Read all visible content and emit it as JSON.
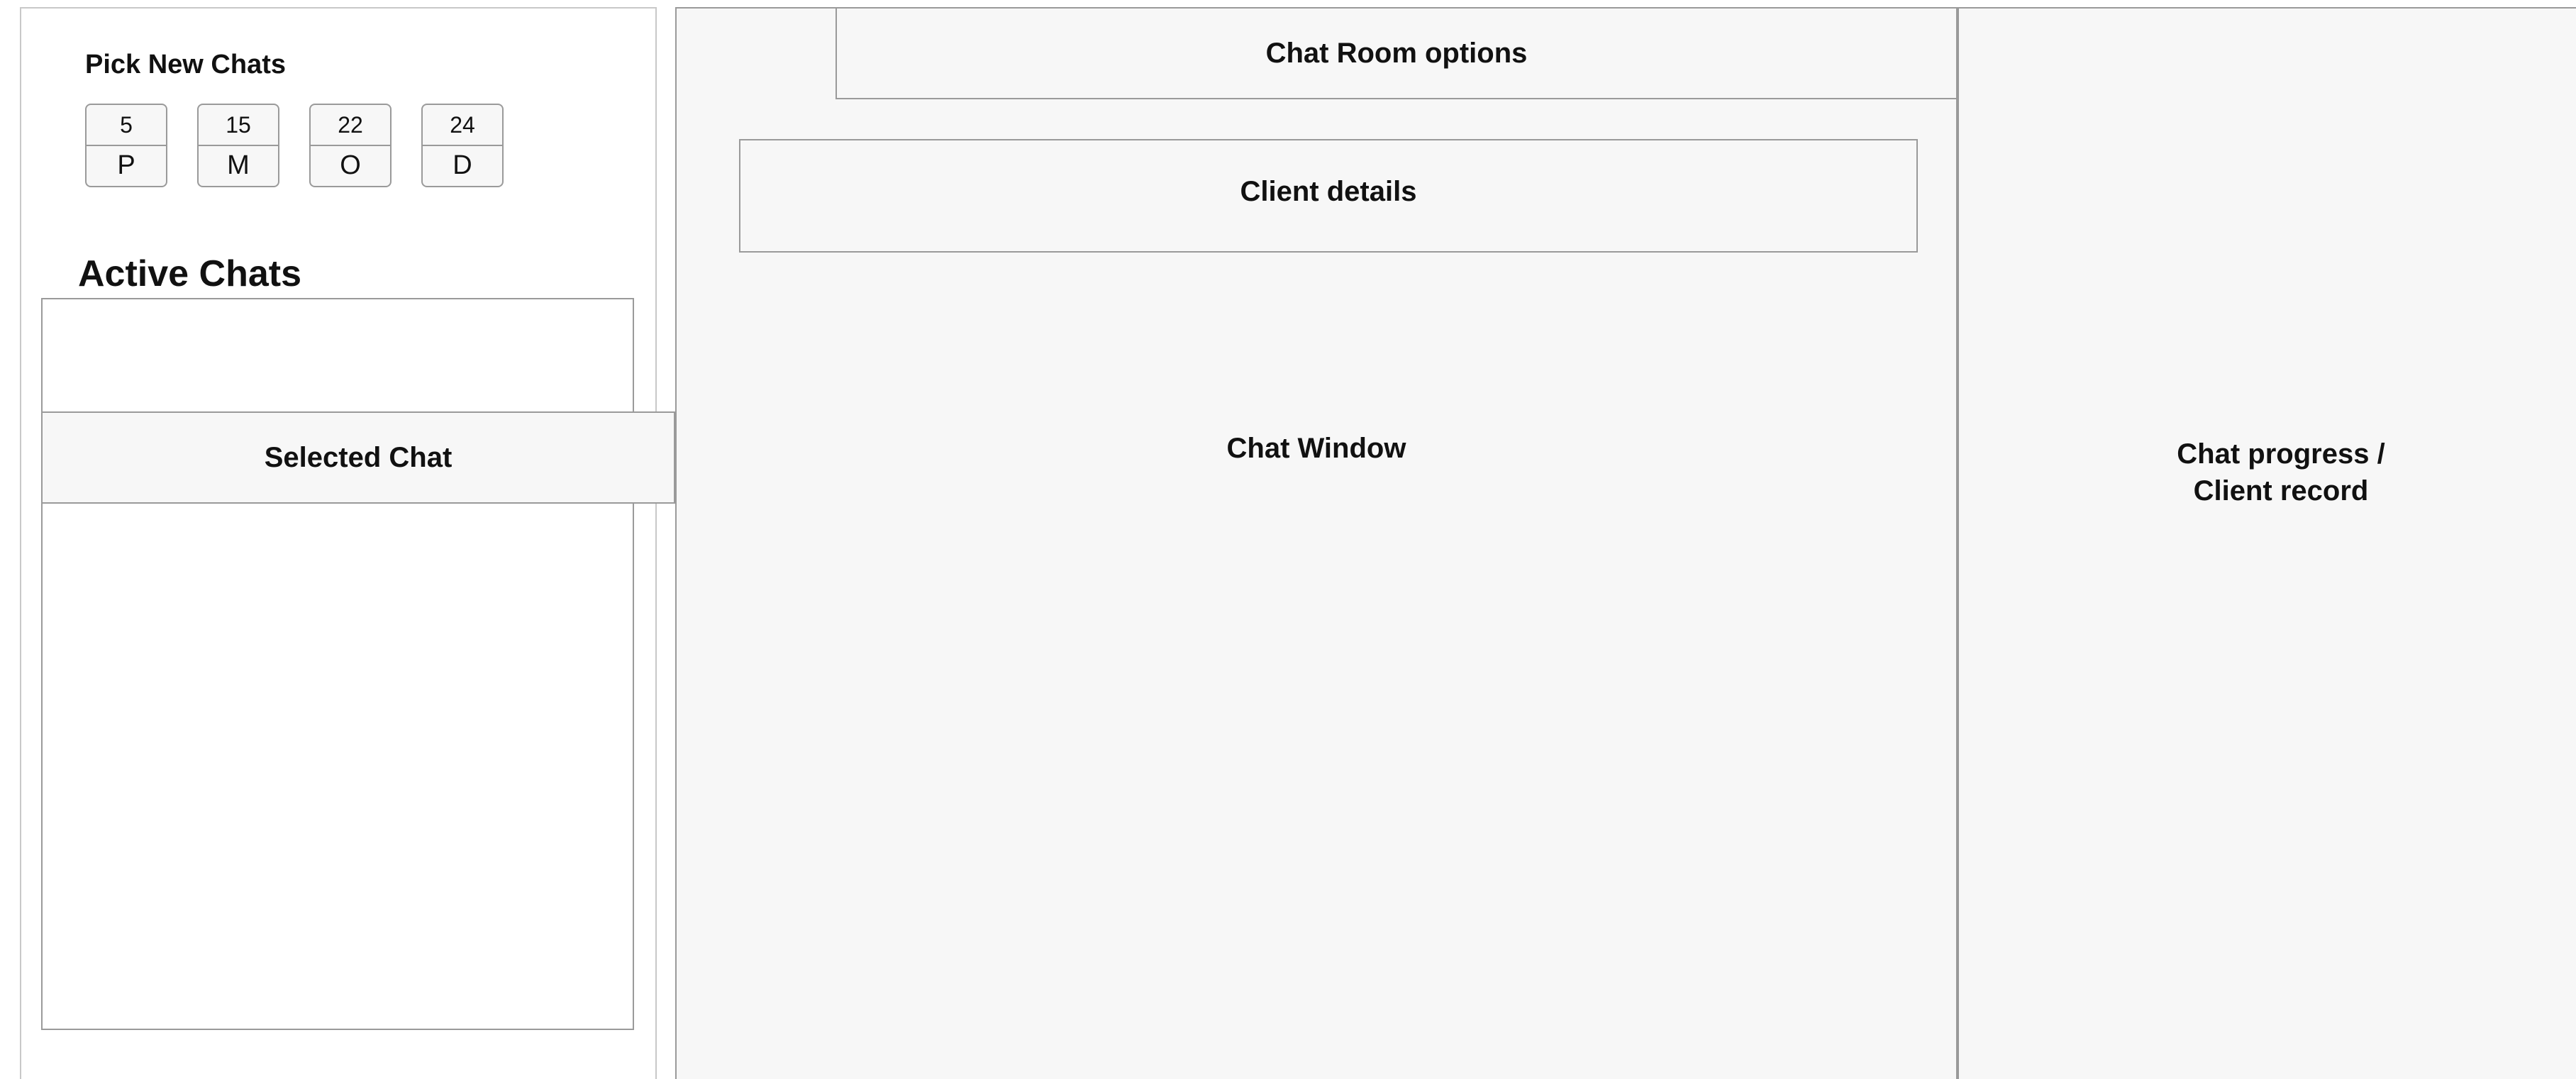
{
  "left_panel": {
    "pick_new_chats_title": "Pick New Chats",
    "queues": [
      {
        "count": "5",
        "letter": "P"
      },
      {
        "count": "15",
        "letter": "M"
      },
      {
        "count": "22",
        "letter": "O"
      },
      {
        "count": "24",
        "letter": "D"
      }
    ],
    "active_chats_title": "Active Chats",
    "selected_chat_label": "Selected Chat"
  },
  "chat_area": {
    "room_options_label": "Chat Room options",
    "client_details_label": "Client details",
    "chat_window_label": "Chat Window"
  },
  "right_panel": {
    "progress_line1": "Chat progress /",
    "progress_line2": "Client record"
  }
}
